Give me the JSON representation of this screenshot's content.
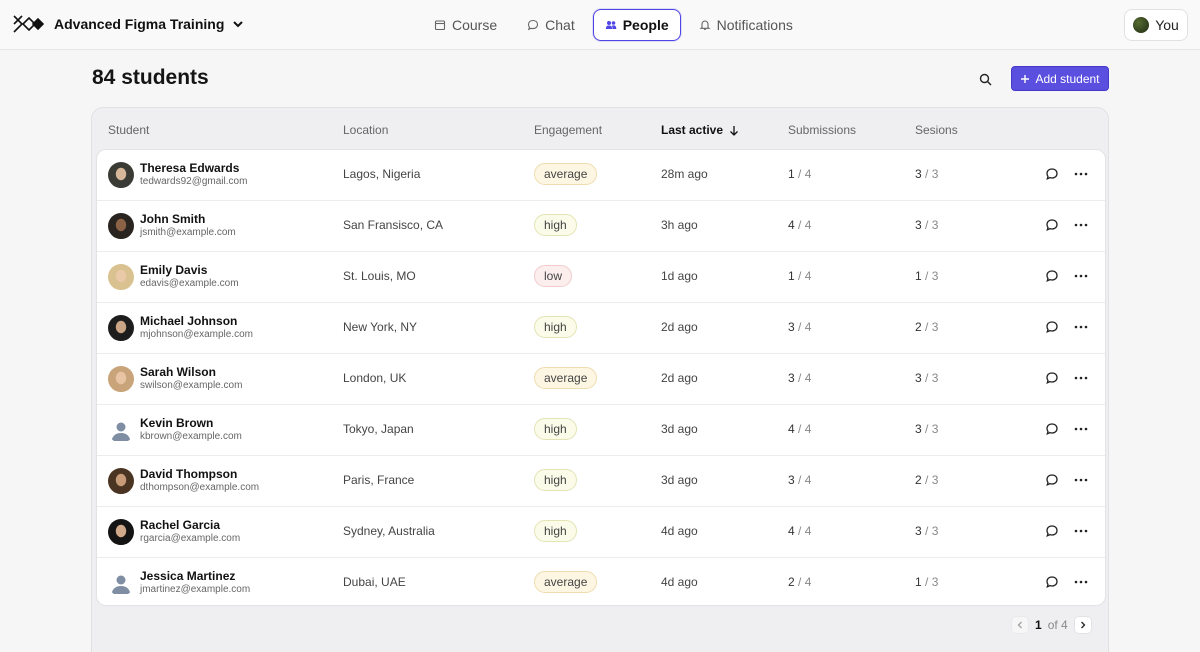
{
  "topbar": {
    "course_name": "Advanced Figma Training",
    "nav": [
      {
        "label": "Course",
        "icon": "calendar-icon"
      },
      {
        "label": "Chat",
        "icon": "chat-bubble-icon"
      },
      {
        "label": "People",
        "icon": "people-icon",
        "active": true
      },
      {
        "label": "Notifications",
        "icon": "bell-icon"
      }
    ],
    "user_label": "You"
  },
  "header": {
    "title": "84 students",
    "add_label": "Add student"
  },
  "table": {
    "columns": {
      "student": "Student",
      "location": "Location",
      "engagement": "Engagement",
      "last_active": "Last active",
      "submissions": "Submissions",
      "sessions": "Sesions"
    },
    "sort_column": "last_active",
    "sort_direction": "descending",
    "rows": [
      {
        "name": "Theresa Edwards",
        "email": "tedwards92@gmail.com",
        "location": "Lagos, Nigeria",
        "engagement": "average",
        "last_active": "28m ago",
        "sub_done": "1",
        "sub_total": "/ 4",
        "sess_done": "3",
        "sess_total": "/ 3",
        "avatar": "photo"
      },
      {
        "name": "John Smith",
        "email": "jsmith@example.com",
        "location": "San Fransisco, CA",
        "engagement": "high",
        "last_active": "3h ago",
        "sub_done": "4",
        "sub_total": "/ 4",
        "sess_done": "3",
        "sess_total": "/ 3",
        "avatar": "photo"
      },
      {
        "name": "Emily Davis",
        "email": "edavis@example.com",
        "location": "St. Louis, MO",
        "engagement": "low",
        "last_active": "1d ago",
        "sub_done": "1",
        "sub_total": "/ 4",
        "sess_done": "1",
        "sess_total": "/ 3",
        "avatar": "photo"
      },
      {
        "name": "Michael Johnson",
        "email": "mjohnson@example.com",
        "location": "New York, NY",
        "engagement": "high",
        "last_active": "2d ago",
        "sub_done": "3",
        "sub_total": "/ 4",
        "sess_done": "2",
        "sess_total": "/ 3",
        "avatar": "photo"
      },
      {
        "name": "Sarah Wilson",
        "email": "swilson@example.com",
        "location": "London, UK",
        "engagement": "average",
        "last_active": "2d ago",
        "sub_done": "3",
        "sub_total": "/ 4",
        "sess_done": "3",
        "sess_total": "/ 3",
        "avatar": "photo"
      },
      {
        "name": "Kevin Brown",
        "email": "kbrown@example.com",
        "location": "Tokyo, Japan",
        "engagement": "high",
        "last_active": "3d ago",
        "sub_done": "4",
        "sub_total": "/ 4",
        "sess_done": "3",
        "sess_total": "/ 3",
        "avatar": "placeholder"
      },
      {
        "name": "David Thompson",
        "email": "dthompson@example.com",
        "location": "Paris, France",
        "engagement": "high",
        "last_active": "3d ago",
        "sub_done": "3",
        "sub_total": "/ 4",
        "sess_done": "2",
        "sess_total": "/ 3",
        "avatar": "photo"
      },
      {
        "name": "Rachel Garcia",
        "email": "rgarcia@example.com",
        "location": "Sydney, Australia",
        "engagement": "high",
        "last_active": "4d ago",
        "sub_done": "4",
        "sub_total": "/ 4",
        "sess_done": "3",
        "sess_total": "/ 3",
        "avatar": "photo"
      },
      {
        "name": "Jessica Martinez",
        "email": "jmartinez@example.com",
        "location": "Dubai, UAE",
        "engagement": "average",
        "last_active": "4d ago",
        "sub_done": "2",
        "sub_total": "/ 4",
        "sess_done": "1",
        "sess_total": "/ 3",
        "avatar": "placeholder"
      }
    ]
  },
  "pagination": {
    "current": "1",
    "of_label": "of 4"
  },
  "colors": {
    "accent": "#5b4fe0",
    "badge_average": "#fdf6e3",
    "badge_high": "#fbfbe9",
    "badge_low": "#fdeeee"
  }
}
